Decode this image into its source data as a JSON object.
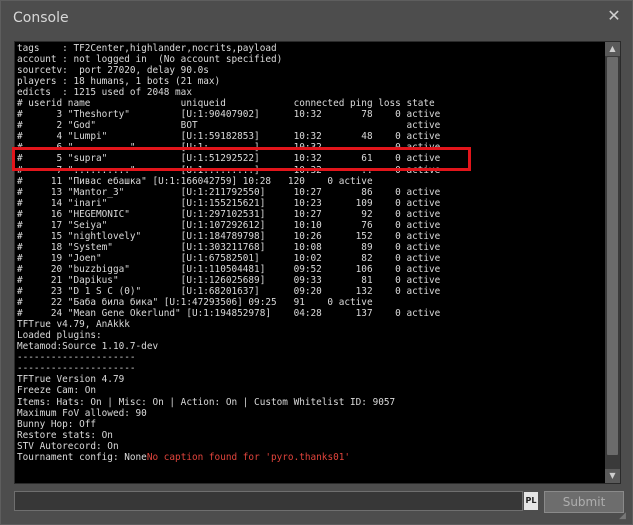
{
  "window": {
    "title": "Console",
    "close_glyph": "✕"
  },
  "output": {
    "lines": [
      {
        "text": "tags    : TF2Center,highlander,nocrits,payload"
      },
      {
        "text": "account : not logged in  (No account specified)"
      },
      {
        "text": "sourcetv:  port 27020, delay 90.0s"
      },
      {
        "text": "players : 18 humans, 1 bots (21 max)"
      },
      {
        "text": "edicts  : 1215 used of 2048 max"
      },
      {
        "text": "# userid name                uniqueid            connected ping loss state"
      },
      {
        "text": "#      3 \"Theshorty\"         [U:1:90407902]      10:32       78    0 active"
      },
      {
        "text": "#      2 \"God\"               BOT                                     active"
      },
      {
        "text": "#      4 \"Lumpi\"             [U:1:59182853]      10:32       48    0 active"
      },
      {
        "text": "#      6 \"..........\"        [U:1:........]      10:32       ..    0 active"
      },
      {
        "text": "#      5 \"supra\"             [U:1:51292522]      10:32       61    0 active"
      },
      {
        "text": "#      7 \"..........\"        [U:1:........]      10:32       ..    0 active"
      },
      {
        "text": "#     11 \"Пивас ебашка\" [U:1:166042759] 10:28   120    0 active"
      },
      {
        "text": "#     13 \"Mantor_3\"          [U:1:211792550]     10:27       86    0 active"
      },
      {
        "text": "#     14 \"inari\"             [U:1:155215621]     10:23      109    0 active"
      },
      {
        "text": "#     16 \"HEGEMONIC\"         [U:1:297102531]     10:27       92    0 active"
      },
      {
        "text": "#     17 \"Seiya\"             [U:1:107292612]     10:10       76    0 active"
      },
      {
        "text": "#     15 \"nightlovely\"       [U:1:184789798]     10:26      152    0 active"
      },
      {
        "text": "#     18 \"System\"            [U:1:303211768]     10:08       89    0 active"
      },
      {
        "text": "#     19 \"Joen\"              [U:1:67582501]      10:02       82    0 active"
      },
      {
        "text": "#     20 \"buzzbigga\"         [U:1:110504481]     09:52      106    0 active"
      },
      {
        "text": "#     21 \"Dapikus\"           [U:1:126025689]     09:33       81    0 active"
      },
      {
        "text": "#     23 \"D 1 S C (0)\"       [U:1:68201637]      09:20      132    0 active"
      },
      {
        "text": "#     22 \"Баба била бика\" [U:1:47293506] 09:25   91    0 active"
      },
      {
        "text": "#     24 \"Mean Gene Okerlund\" [U:1:194852978]    04:28      137    0 active"
      },
      {
        "text": "TFTrue v4.79, AnAkkk"
      },
      {
        "text": "Loaded plugins:"
      },
      {
        "text": "Metamod:Source 1.10.7-dev"
      },
      {
        "text": "---------------------"
      },
      {
        "text": "---------------------"
      },
      {
        "text": "TFTrue Version 4.79"
      },
      {
        "text": "Freeze Cam: On"
      },
      {
        "text": "Items: Hats: On | Misc: On | Action: On | Custom Whitelist ID: 9057"
      },
      {
        "text": "Maximum FoV allowed: 90"
      },
      {
        "text": "Bunny Hop: Off"
      },
      {
        "text": "Restore stats: On"
      },
      {
        "text": "STV Autorecord: On"
      },
      {
        "text": "Tournament config: None",
        "error": "No caption found for 'pyro.thanks01'"
      }
    ]
  },
  "input": {
    "value": "",
    "locale_badge": "PL"
  },
  "submit": {
    "label": "Submit"
  },
  "colors": {
    "window_bg": "#4d4d4d",
    "output_bg": "#000000",
    "text": "#dadada",
    "error_text": "#e0443c",
    "highlight": "#e2151b"
  },
  "icons": {
    "close": "close-icon",
    "scroll_up": "scroll-up-arrow-icon",
    "scroll_down": "scroll-down-arrow-icon",
    "resize": "resize-grip-icon"
  }
}
